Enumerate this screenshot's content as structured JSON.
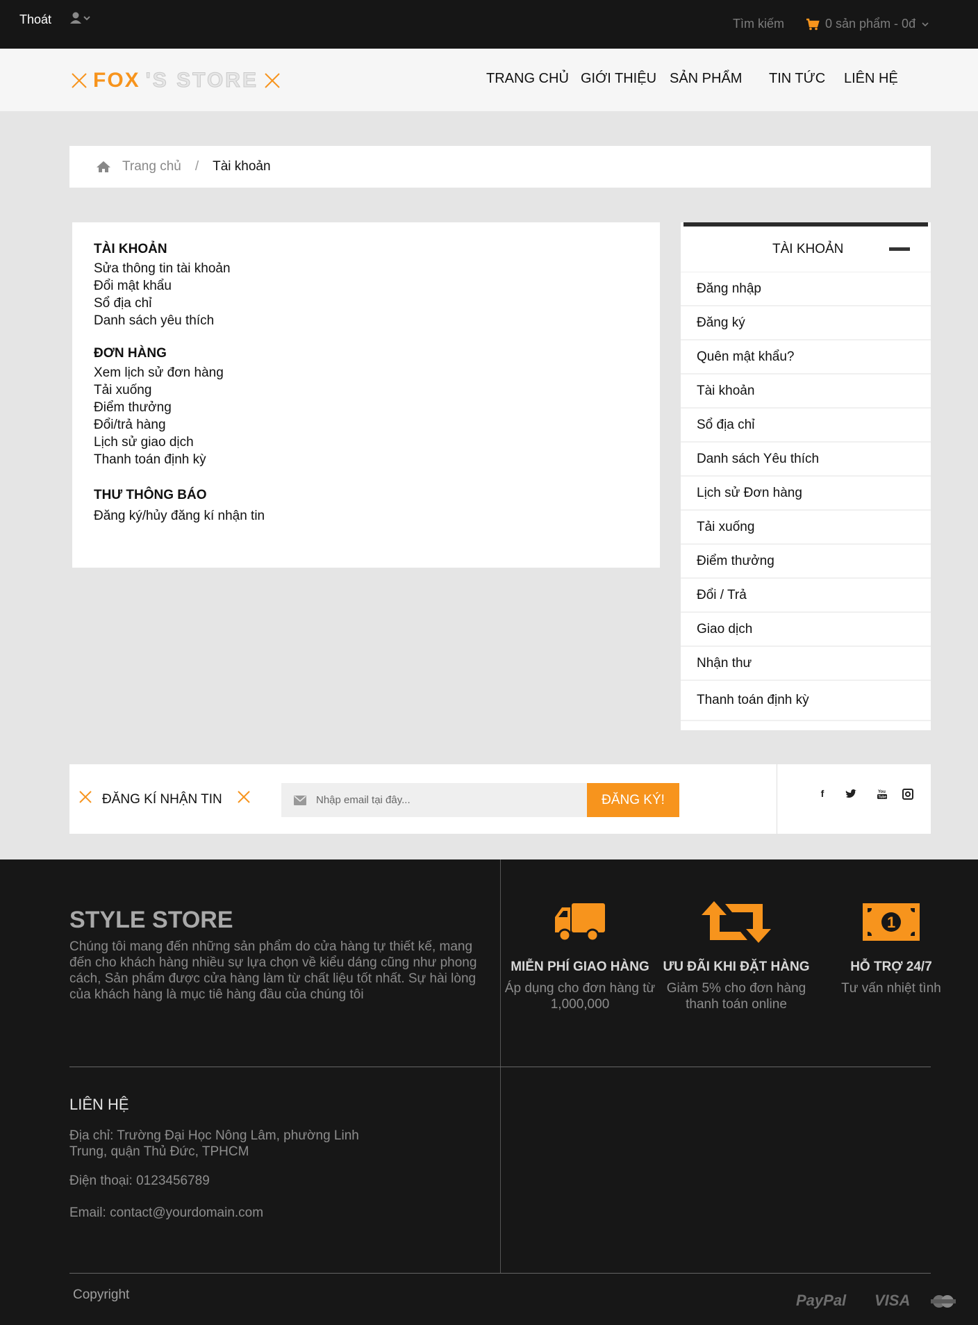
{
  "topbar": {
    "logout": "Thoát",
    "search": "Tìm kiếm",
    "cart": "0 sản phẩm - 0đ"
  },
  "header": {
    "logo_primary": "FOX",
    "logo_secondary": "'S STORE",
    "nav": [
      "TRANG CHỦ",
      "GIỚI THIỆU",
      "SẢN PHẨM",
      "TIN TỨC",
      "LIÊN HỆ"
    ]
  },
  "breadcrumb": {
    "home": "Trang chủ",
    "separator": "/",
    "current": "Tài khoản"
  },
  "account": {
    "groups": [
      {
        "title": "TÀI KHOẢN",
        "items": [
          "Sửa thông tin tài khoản",
          "Đổi mật khẩu",
          "Sổ địa chỉ",
          "Danh sách yêu thích"
        ]
      },
      {
        "title": "ĐƠN HÀNG",
        "items": [
          "Xem lịch sử đơn hàng",
          "Tải xuống",
          "Điểm thưởng",
          "Đổi/trả hàng",
          "Lịch sử giao dịch",
          "Thanh toán định kỳ"
        ]
      },
      {
        "title": "THƯ THÔNG BÁO",
        "items": [
          "Đăng ký/hủy đăng kí nhận tin"
        ]
      }
    ]
  },
  "sidebar": {
    "title": "TÀI KHOẢN",
    "items": [
      "Đăng nhập",
      "Đăng ký",
      "Quên mật khẩu?",
      "Tài khoản",
      "Sổ địa chỉ",
      "Danh sách Yêu thích",
      "Lịch sử Đơn hàng",
      "Tải xuống",
      "Điểm thưởng",
      "Đổi / Trả",
      "Giao dịch",
      "Nhận thư",
      "Thanh toán định kỳ"
    ]
  },
  "newsletter": {
    "label": "ĐĂNG KÍ NHẬN TIN",
    "placeholder": "Nhập email tại đây...",
    "button": "ĐĂNG KÝ!"
  },
  "footer": {
    "title": "STYLE STORE",
    "about": "Chúng tôi mang đến những sản phẩm do cửa hàng tự thiết kế, mang đến cho khách hàng nhiều sự lựa chọn về kiểu dáng cũng như phong cách, Sản phẩm được cửa hàng làm từ chất liệu tốt nhất. Sự hài lòng của khách hàng là mục tiê hàng đầu của chúng tôi",
    "features": [
      {
        "title": "MIỄN PHÍ GIAO HÀNG",
        "desc": "Áp dụng cho đơn hàng từ 1,000,000",
        "icon": "truck-icon"
      },
      {
        "title": "ƯU ĐÃI KHI ĐẶT HÀNG",
        "desc": "Giảm 5% cho đơn hàng thanh toán online",
        "icon": "retweet-icon"
      },
      {
        "title": "HỖ TRỢ 24/7",
        "desc": "Tư vấn nhiệt tình",
        "icon": "money-icon"
      }
    ],
    "contact_title": "LIÊN HỆ",
    "address": "Địa chỉ: Trường Đại Học Nông Lâm, phường Linh Trung, quận Thủ Đức, TPHCM",
    "phone": "Điện thoại: 0123456789",
    "email": "Email: contact@yourdomain.com",
    "copyright": "Copyright",
    "payments": [
      "PayPal",
      "VISA"
    ]
  },
  "colors": {
    "accent": "#f7941d",
    "topbar": "#161616",
    "footer": "#171717"
  }
}
